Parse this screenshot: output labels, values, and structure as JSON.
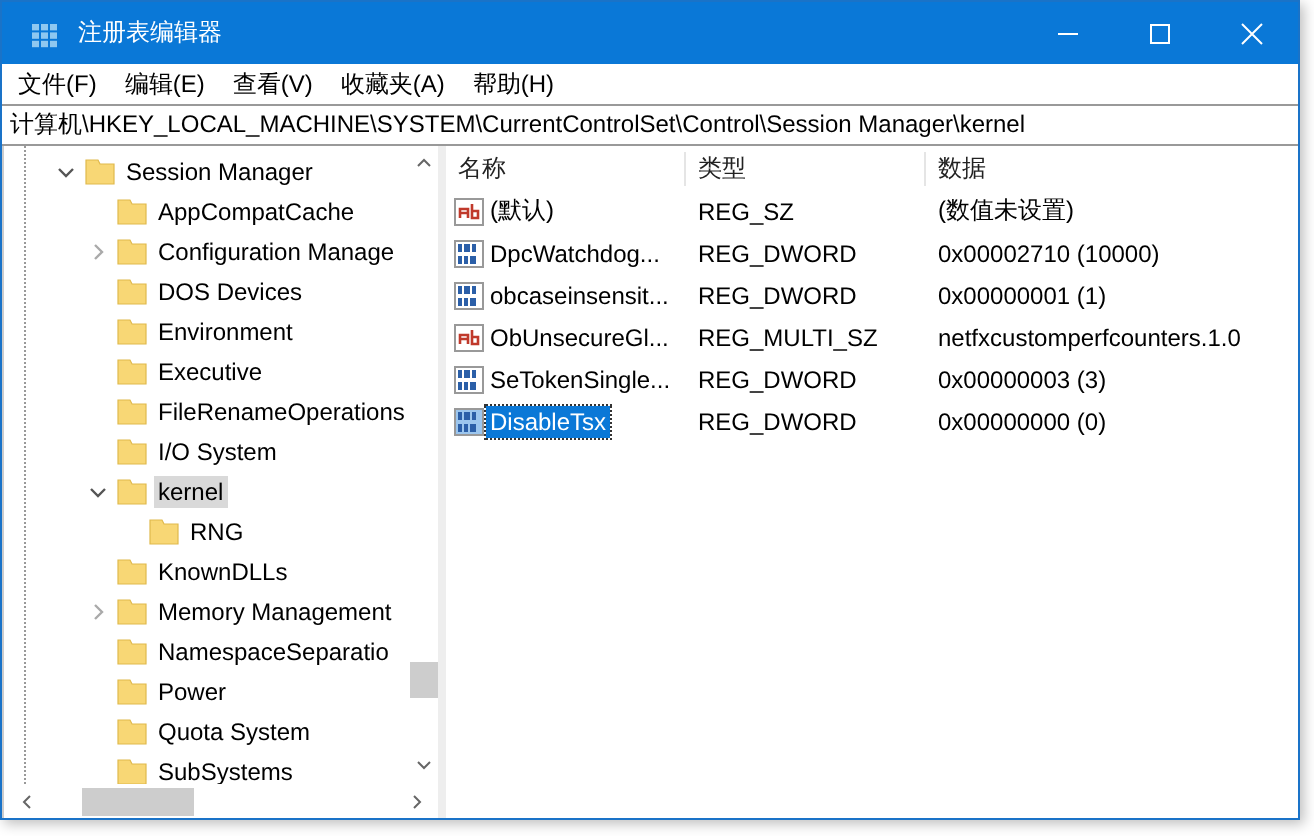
{
  "window": {
    "title": "注册表编辑器"
  },
  "menu": [
    "文件(F)",
    "编辑(E)",
    "查看(V)",
    "收藏夹(A)",
    "帮助(H)"
  ],
  "address": "计算机\\HKEY_LOCAL_MACHINE\\SYSTEM\\CurrentControlSet\\Control\\Session Manager\\kernel",
  "tree": [
    {
      "label": "Session Manager",
      "expanded": true,
      "selected": false,
      "children": [
        {
          "label": "AppCompatCache",
          "selected": false
        },
        {
          "label": "Configuration Manage",
          "expanded": false,
          "selected": false
        },
        {
          "label": "DOS Devices",
          "selected": false
        },
        {
          "label": "Environment",
          "selected": false
        },
        {
          "label": "Executive",
          "selected": false
        },
        {
          "label": "FileRenameOperations",
          "selected": false
        },
        {
          "label": "I/O System",
          "selected": false
        },
        {
          "label": "kernel",
          "expanded": true,
          "selected": true,
          "children": [
            {
              "label": "RNG",
              "selected": false
            }
          ]
        },
        {
          "label": "KnownDLLs",
          "selected": false
        },
        {
          "label": "Memory Management",
          "expanded": false,
          "selected": false
        },
        {
          "label": "NamespaceSeparatio",
          "selected": false
        },
        {
          "label": "Power",
          "selected": false
        },
        {
          "label": "Quota System",
          "selected": false
        },
        {
          "label": "SubSystems",
          "selected": false
        }
      ]
    }
  ],
  "table": {
    "columns": [
      "名称",
      "类型",
      "数据"
    ],
    "rows": [
      {
        "kind": "string",
        "name": "(默认)",
        "type": "REG_SZ",
        "data": "(数值未设置)",
        "selected": false
      },
      {
        "kind": "binary",
        "name": "DpcWatchdog...",
        "type": "REG_DWORD",
        "data": "0x00002710 (10000)",
        "selected": false
      },
      {
        "kind": "binary",
        "name": "obcaseinsensit...",
        "type": "REG_DWORD",
        "data": "0x00000001 (1)",
        "selected": false
      },
      {
        "kind": "string",
        "name": "ObUnsecureGl...",
        "type": "REG_MULTI_SZ",
        "data": "netfxcustomperfcounters.1.0",
        "selected": false
      },
      {
        "kind": "binary",
        "name": "SeTokenSingle...",
        "type": "REG_DWORD",
        "data": "0x00000003 (3)",
        "selected": false
      },
      {
        "kind": "binary",
        "name": "DisableTsx",
        "type": "REG_DWORD",
        "data": "0x00000000 (0)",
        "selected": true
      }
    ]
  }
}
